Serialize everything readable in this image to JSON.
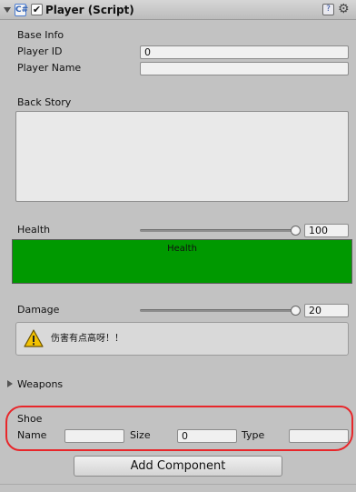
{
  "header": {
    "title": "Player (Script)",
    "script_enabled": "✔",
    "script_icon": "C#",
    "help_icon_glyph": "?",
    "gear_glyph": "⚙"
  },
  "base_info": {
    "heading": "Base Info",
    "player_id_label": "Player ID",
    "player_id_value": "0",
    "player_name_label": "Player Name",
    "player_name_value": ""
  },
  "back_story": {
    "label": "Back Story",
    "value": ""
  },
  "health": {
    "label": "Health",
    "value": "100",
    "slider_fraction": 1.0,
    "bar_label": "Health",
    "bar_color": "#009900"
  },
  "damage": {
    "label": "Damage",
    "value": "20",
    "slider_fraction": 1.0,
    "warning_text": "伤害有点高呀！！",
    "warning_icon": "warning-icon"
  },
  "weapons": {
    "label": "Weapons",
    "expanded": false
  },
  "shoe": {
    "heading": "Shoe",
    "name_label": "Name",
    "name_value": "",
    "size_label": "Size",
    "size_value": "0",
    "type_label": "Type",
    "type_value": "",
    "highlight_color": "#e8262a"
  },
  "footer": {
    "add_component_label": "Add Component"
  }
}
